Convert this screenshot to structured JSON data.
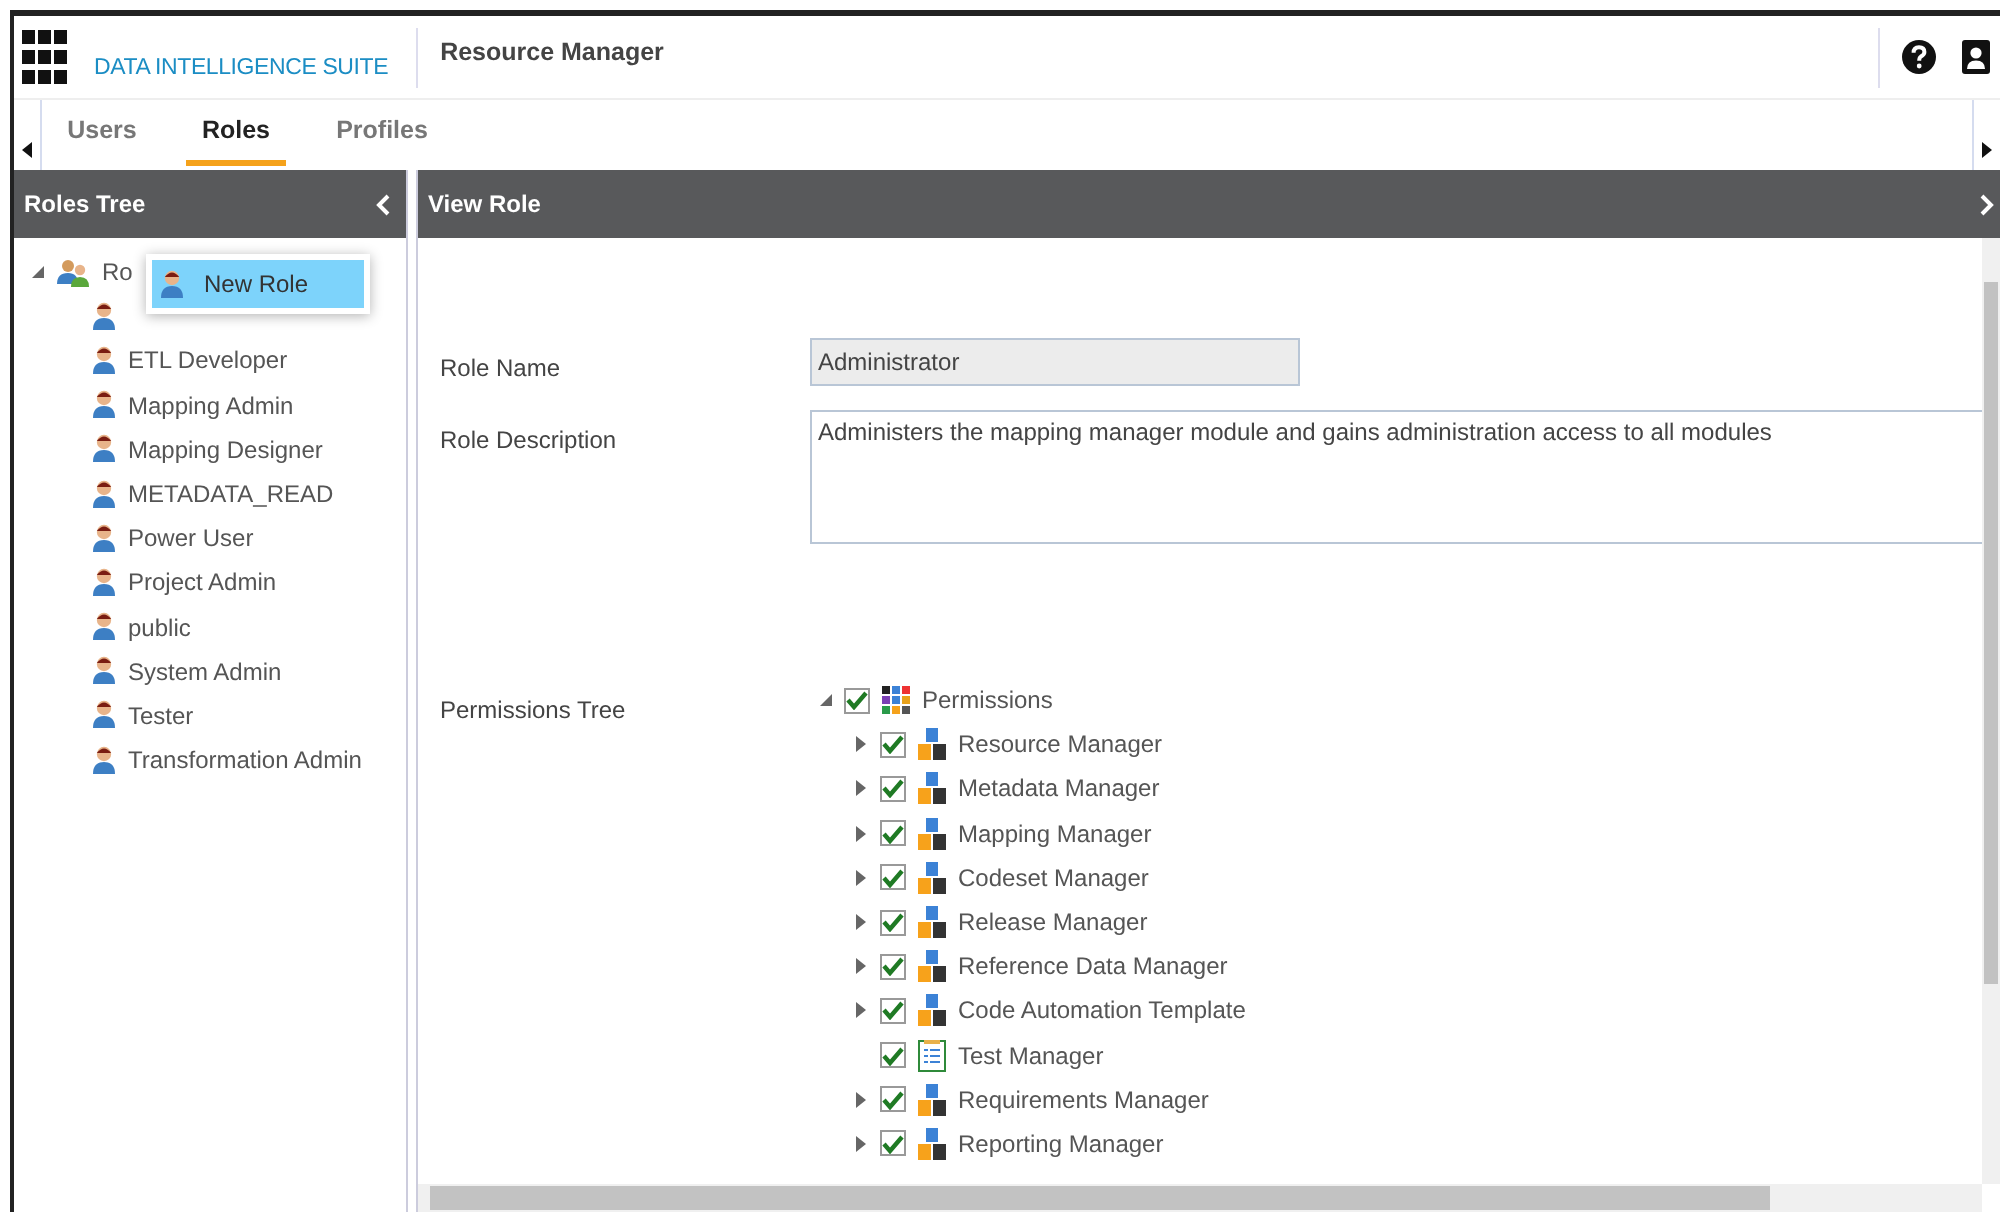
{
  "header": {
    "suite_name": "DATA INTELLIGENCE SUITE",
    "module_title": "Resource Manager"
  },
  "tabs": [
    {
      "label": "Users",
      "selected": false
    },
    {
      "label": "Roles",
      "selected": true
    },
    {
      "label": "Profiles",
      "selected": false
    }
  ],
  "roles_tree": {
    "title": "Roles Tree",
    "root": {
      "label": "Ro",
      "expanded": true,
      "children": [
        {
          "covered": true
        },
        {
          "label": "ETL Developer"
        },
        {
          "label": "Mapping Admin"
        },
        {
          "label": "Mapping Designer"
        },
        {
          "label": "METADATA_READ"
        },
        {
          "label": "Power User"
        },
        {
          "label": "Project Admin"
        },
        {
          "label": "public"
        },
        {
          "label": "System Admin"
        },
        {
          "label": "Tester"
        },
        {
          "label": "Transformation Admin"
        }
      ]
    }
  },
  "context_menu": {
    "items": [
      {
        "label": "New Role",
        "selected": true
      }
    ]
  },
  "view_role": {
    "title": "View Role",
    "role_name_label": "Role Name",
    "role_name": "Administrator",
    "role_name_disabled": true,
    "role_description_label": "Role Description",
    "role_description": "Administers the mapping manager module and gains administration access to all modules",
    "permissions_tree_label": "Permissions Tree",
    "permissions": {
      "label": "Permissions",
      "checked": true,
      "expanded": true,
      "children": [
        {
          "label": "Resource Manager",
          "kind": "module",
          "checked": true,
          "expandable": true
        },
        {
          "label": "Metadata Manager",
          "kind": "module",
          "checked": true,
          "expandable": true
        },
        {
          "label": "Mapping Manager",
          "kind": "module",
          "checked": true,
          "expandable": true
        },
        {
          "label": "Codeset Manager",
          "kind": "module",
          "checked": true,
          "expandable": true
        },
        {
          "label": "Release Manager",
          "kind": "module",
          "checked": true,
          "expandable": true
        },
        {
          "label": "Reference Data Manager",
          "kind": "module",
          "checked": true,
          "expandable": true
        },
        {
          "label": "Code Automation Template",
          "kind": "module",
          "checked": true,
          "expandable": true
        },
        {
          "label": "Test Manager",
          "kind": "test",
          "checked": true,
          "expandable": false
        },
        {
          "label": "Requirements Manager",
          "kind": "module",
          "checked": true,
          "expandable": true
        },
        {
          "label": "Reporting Manager",
          "kind": "module",
          "checked": true,
          "expandable": true
        }
      ]
    }
  }
}
